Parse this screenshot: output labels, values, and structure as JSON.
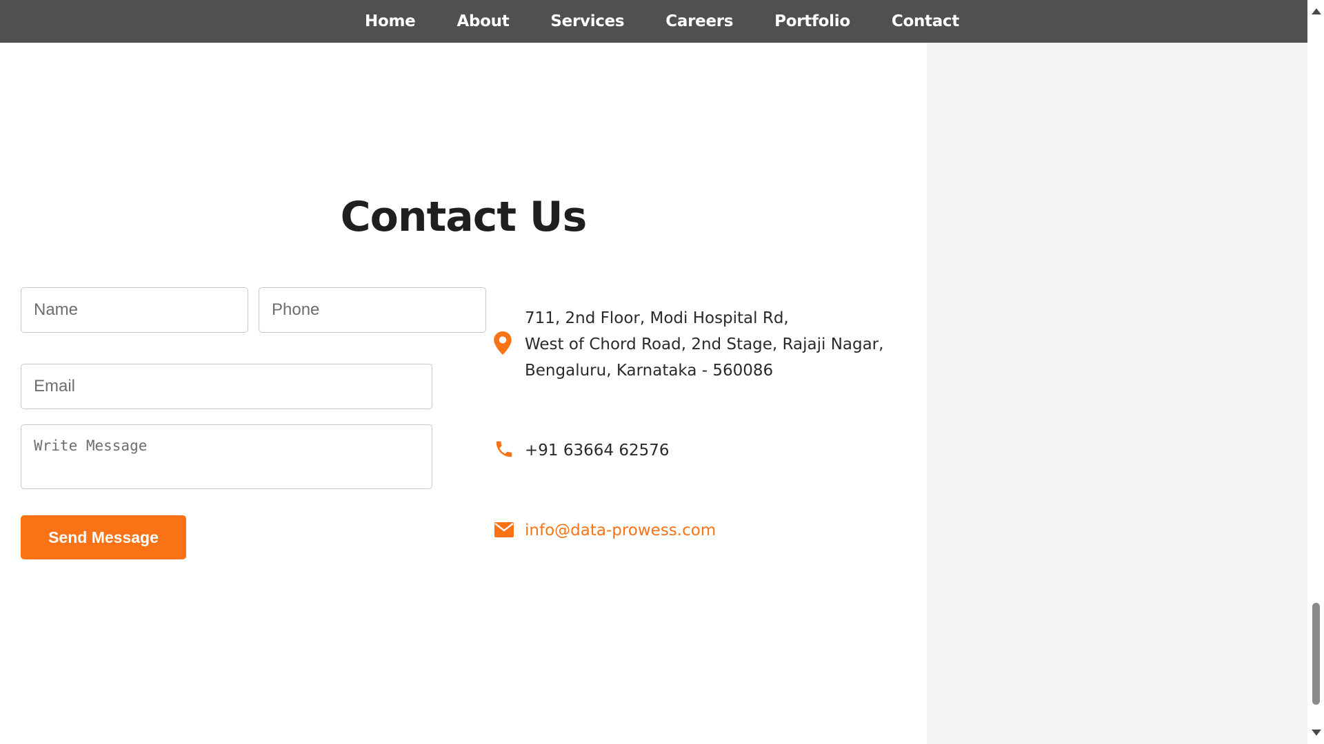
{
  "nav": {
    "items": [
      {
        "label": "Home"
      },
      {
        "label": "About"
      },
      {
        "label": "Services"
      },
      {
        "label": "Careers"
      },
      {
        "label": "Portfolio"
      },
      {
        "label": "Contact"
      }
    ]
  },
  "contact": {
    "title": "Contact Us",
    "form": {
      "name_placeholder": "Name",
      "phone_placeholder": "Phone",
      "email_placeholder": "Email",
      "message_placeholder": "Write Message",
      "send_label": "Send Message"
    },
    "info": {
      "address_lines": [
        "711, 2nd Floor, Modi Hospital Rd,",
        "West of Chord Road, 2nd Stage, Rajaji Nagar,",
        "Bengaluru, Karnataka - 560086"
      ],
      "phone": "+91 63664 62576",
      "email": "info@data-prowess.com",
      "icons": [
        "map-pin-icon",
        "phone-icon",
        "envelope-icon"
      ]
    }
  },
  "colors": {
    "accent": "#f97316",
    "navbar": "#505050",
    "side_panel": "#f4f4f4"
  }
}
